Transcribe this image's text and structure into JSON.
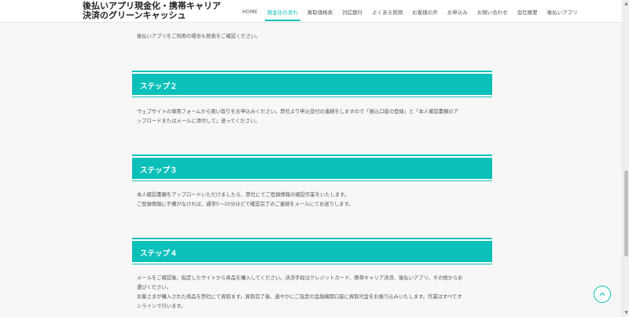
{
  "header": {
    "logo_line1": "後払いアプリ現金化・携帯キャリア",
    "logo_line2": "決済のグリーンキャッシュ",
    "nav": [
      {
        "label": "HOME"
      },
      {
        "label": "現金化の流れ",
        "active": true
      },
      {
        "label": "買取価格表"
      },
      {
        "label": "対応銀行"
      },
      {
        "label": "よくある質問"
      },
      {
        "label": "お客様の声"
      },
      {
        "label": "お申込み"
      },
      {
        "label": "お問い合わせ"
      },
      {
        "label": "会社概要"
      },
      {
        "label": "後払いアプリ"
      }
    ]
  },
  "main": {
    "intro": "後払いアプリをご利用の場合も税表をご確認ください。",
    "steps": [
      {
        "title": "ステップ２",
        "lines": [
          "ウェブサイトの専用フォームから買い取りをお申込みください。弊社より申込受付の連絡をしますので「振込口座の登録」と「本人確認書類のア",
          "ップロードまたはメールに添付して」送ってください。"
        ]
      },
      {
        "title": "ステップ３",
        "lines": [
          "本人確認書類をアップロードいただけましたら、弊社にてご登録情報の確認作業をいたします。",
          "ご登録情報に不備がなければ、通常5～10分ほどで確認完了のご連絡をメールにてお送りします。"
        ]
      },
      {
        "title": "ステップ４",
        "lines": [
          "メールをご確認後、指定したサイトから商品を購入してください。決済手段はクレジットカード、携帯キャリア決済、後払いアプリ、その他からお",
          "選びください。",
          "お客さまが購入された商品を弊社にて買取ます。買取完了後、速やかにご指定の金融機関口座に買取代金をお振り込みいたします。作業はすべてオ",
          "ンラインで行います。"
        ]
      }
    ]
  },
  "colors": {
    "accent": "#0ac0b9",
    "background": "#f7f7f7"
  },
  "icons": {
    "back_to_top": "chevron-up-icon"
  }
}
